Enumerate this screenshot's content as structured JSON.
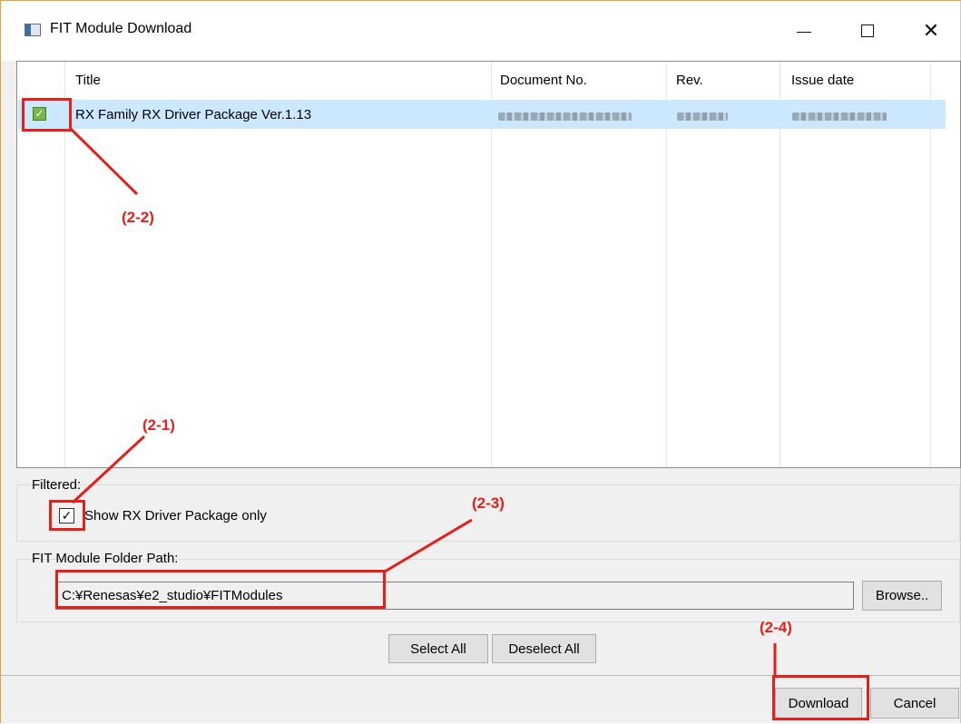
{
  "window": {
    "title": "FIT Module Download",
    "controls": {
      "minimize": "—",
      "maximize": "☐",
      "close": "✕"
    }
  },
  "table": {
    "columns": [
      "Title",
      "Document No.",
      "Rev.",
      "Issue date"
    ],
    "rows": [
      {
        "checked": true,
        "title": "RX Family RX Driver Package Ver.1.13",
        "document_no": "",
        "rev": "",
        "issue_date": ""
      }
    ]
  },
  "filter": {
    "group_label": "Filtered:",
    "checkbox_label": "Show RX Driver Package only",
    "checked": true
  },
  "folder": {
    "group_label": "FIT Module Folder Path:",
    "path": "C:¥Renesas¥e2_studio¥FITModules",
    "browse_label": "Browse.."
  },
  "buttons": {
    "select_all": "Select All",
    "deselect_all": "Deselect All",
    "download": "Download",
    "cancel": "Cancel"
  },
  "annotations": {
    "a1": "(2-1)",
    "a2": "(2-2)",
    "a3": "(2-3)",
    "a4": "(2-4)",
    "color": "#e5201b"
  }
}
